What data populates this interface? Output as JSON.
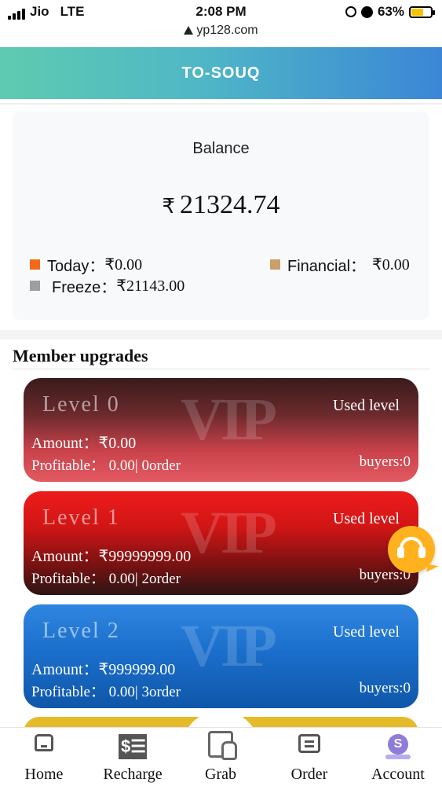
{
  "status_bar": {
    "carrier": "Jio",
    "network": "LTE",
    "time": "2:08 PM",
    "battery": "63%",
    "battery_level": 0.63,
    "icons": [
      "signal-icon",
      "lock-rotation-icon",
      "alarm-icon",
      "battery-charging-icon"
    ]
  },
  "browser": {
    "url": "yp128.com",
    "icon": "warning-triangle-icon"
  },
  "header": {
    "title": "TO-SOUQ",
    "gradient": [
      "#5ecbb0",
      "#3b86d6"
    ]
  },
  "balance": {
    "title": "Balance",
    "currency": "₹",
    "amount": "21324.74",
    "stats": [
      {
        "label": "Today：",
        "value": "₹0.00",
        "color": "#f26a1b"
      },
      {
        "label": "Freeze：",
        "value": "₹21143.00",
        "color": "#9e9e9e"
      },
      {
        "label": "Financial：",
        "value": "₹0.00",
        "color": "#c9a06a"
      }
    ]
  },
  "member_upgrades": {
    "title": "Member upgrades",
    "watermark": "VIP",
    "levels": [
      {
        "name": "Level 0",
        "status": "Used level",
        "amount": "Amount：₹0.00",
        "profit": "Profitable： 0.00| 0order",
        "buyers": "buyers:0"
      },
      {
        "name": "Level 1",
        "status": "Used level",
        "amount": "Amount：₹99999999.00",
        "profit": "Profitable： 0.00| 2order",
        "buyers": "buyers:0"
      },
      {
        "name": "Level 2",
        "status": "Used level",
        "amount": "Amount：₹999999.00",
        "profit": "Profitable： 0.00| 3order",
        "buyers": "buyers:0"
      }
    ]
  },
  "support_button": {
    "icon": "headset-icon",
    "color": "#ffb21e"
  },
  "bottom_nav": [
    {
      "label": "Home",
      "icon": "home-icon"
    },
    {
      "label": "Recharge",
      "icon": "recharge-icon",
      "glyph": "$☰"
    },
    {
      "label": "Grab",
      "icon": "grab-icon"
    },
    {
      "label": "Order",
      "icon": "order-icon"
    },
    {
      "label": "Account",
      "icon": "account-icon",
      "glyph": "S"
    }
  ]
}
